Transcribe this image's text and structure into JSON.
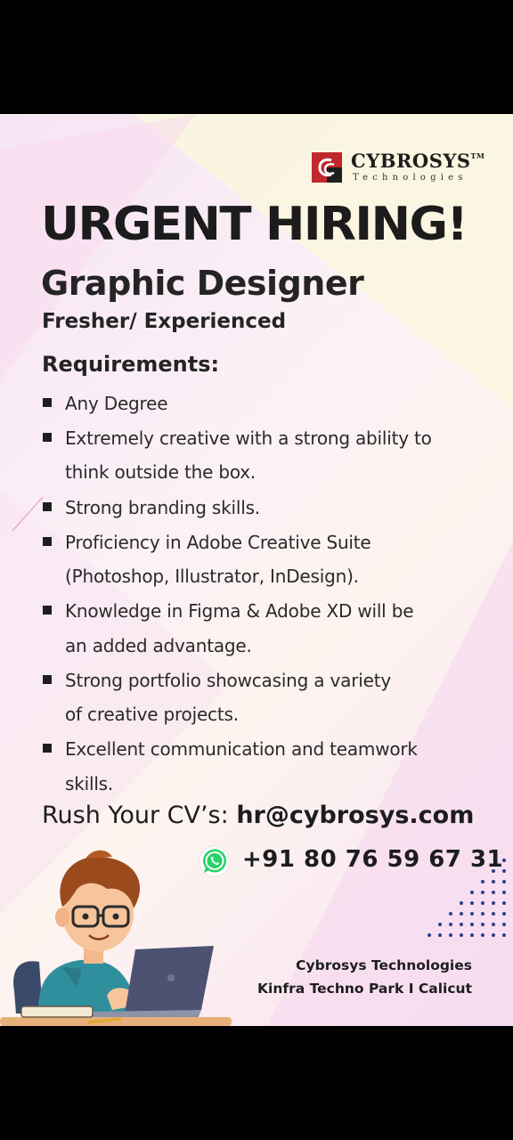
{
  "brand": {
    "name": "CYBROSYS",
    "trademark": "TM",
    "tagline": "Technologies",
    "logo_color": "#c0282e"
  },
  "headline": "URGENT HIRING!",
  "role": "Graphic Designer",
  "level": "Fresher/ Experienced",
  "requirements_title": "Requirements:",
  "requirements": [
    {
      "lines": [
        "Any Degree"
      ]
    },
    {
      "lines": [
        "Extremely creative with a strong ability to",
        "think outside the box."
      ]
    },
    {
      "lines": [
        "Strong branding skills."
      ]
    },
    {
      "lines": [
        "Proficiency in Adobe Creative Suite",
        "(Photoshop, Illustrator, InDesign)."
      ]
    },
    {
      "lines": [
        "Knowledge in Figma & Adobe XD will be",
        "an added advantage."
      ]
    },
    {
      "lines": [
        "Strong portfolio showcasing a variety",
        "of creative projects."
      ]
    },
    {
      "lines": [
        "Excellent communication and teamwork",
        "skills."
      ]
    }
  ],
  "contact": {
    "cv_label": "Rush Your CV’s:",
    "email": "hr@cybrosys.com",
    "phone": "+91 80 76 59 67 31",
    "phone_icon": "whatsapp-icon",
    "whatsapp_color": "#25d366"
  },
  "address": {
    "line1": "Cybrosys Technologies",
    "line2": "Kinfra Techno Park I Calicut"
  },
  "colors": {
    "dots": "#2d3f8c",
    "text": "#1e1e1e"
  }
}
